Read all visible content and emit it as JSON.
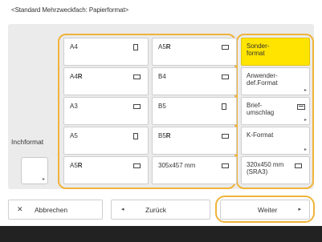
{
  "title": "<Standard Mehrzweckfach: Papierformat>",
  "side": {
    "label": "Inchformat",
    "button_arrow": "▸"
  },
  "grid": [
    {
      "label": "A4",
      "bold": "",
      "icon": "portrait-page-icon",
      "orient": "portrait"
    },
    {
      "label": "A5",
      "bold": "R",
      "icon": "landscape-page-icon",
      "orient": "landscape"
    },
    {
      "label": "A4",
      "bold": "R",
      "icon": "landscape-page-icon",
      "orient": "landscape"
    },
    {
      "label": "B4",
      "bold": "",
      "icon": "landscape-page-icon",
      "orient": "landscape"
    },
    {
      "label": "A3",
      "bold": "",
      "icon": "landscape-page-icon",
      "orient": "landscape"
    },
    {
      "label": "B5",
      "bold": "",
      "icon": "portrait-page-icon",
      "orient": "portrait"
    },
    {
      "label": "A5",
      "bold": "",
      "icon": "portrait-page-icon",
      "orient": "portrait"
    },
    {
      "label": "B5",
      "bold": "R",
      "icon": "landscape-page-icon",
      "orient": "landscape"
    },
    {
      "label": "A5",
      "bold": "R",
      "icon": "landscape-page-icon",
      "orient": "landscape"
    },
    {
      "label": "305x457 mm",
      "bold": "",
      "icon": "landscape-page-icon",
      "orient": "landscape"
    }
  ],
  "right": [
    {
      "label": "Sonder-\nformat",
      "selected": true,
      "arrow": ""
    },
    {
      "label": "Anwender-\ndef.Format",
      "selected": false,
      "arrow": "▸"
    },
    {
      "label": "Brief-\numschlag",
      "selected": false,
      "arrow": "▸"
    },
    {
      "label": "K-Format",
      "selected": false,
      "arrow": "▸"
    },
    {
      "label": "320x450 mm\n(SRA3)",
      "selected": false,
      "arrow": ""
    }
  ],
  "footer": {
    "cancel": "Abbrechen",
    "cancel_icon": "✕",
    "back": "Zurück",
    "back_icon": "◂",
    "next": "Weiter",
    "next_icon": "▸"
  }
}
